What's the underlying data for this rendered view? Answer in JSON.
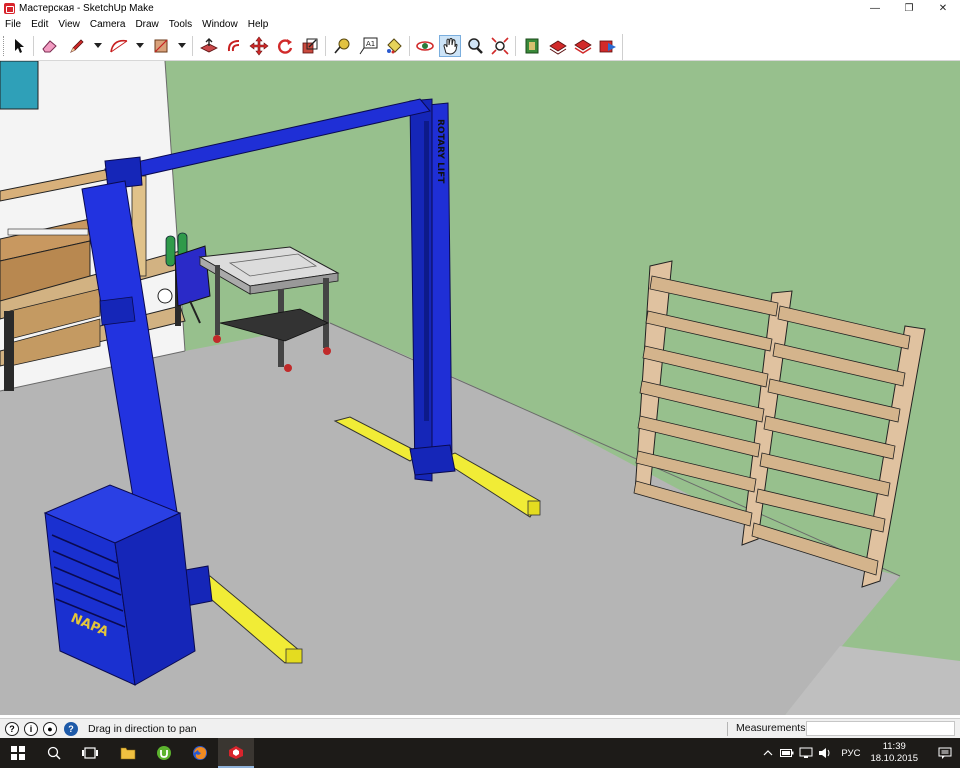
{
  "window": {
    "title": "Мастерская - SketchUp Make",
    "minimize_glyph": "—",
    "restore_glyph": "❐",
    "close_glyph": "✕"
  },
  "menu": {
    "items": [
      "File",
      "Edit",
      "View",
      "Camera",
      "Draw",
      "Tools",
      "Window",
      "Help"
    ]
  },
  "toolbar": {
    "active_tool": "pan-tool"
  },
  "scene": {
    "lift_label": "ROTARY LIFT",
    "cabinet_label": "NAPA",
    "colors": {
      "wall": "#97c08d",
      "floor": "#b6b6b6",
      "lift": "#1f2fd6",
      "arms": "#f1ec36",
      "shelf": "#e2c5a0",
      "cabinet": "#1a30d0"
    }
  },
  "status": {
    "hint": "Drag in direction to pan",
    "measurements_label": "Measurements",
    "measurements_value": ""
  },
  "taskbar": {
    "language": "РУС",
    "time": "11:39",
    "date": "18.10.2015"
  }
}
